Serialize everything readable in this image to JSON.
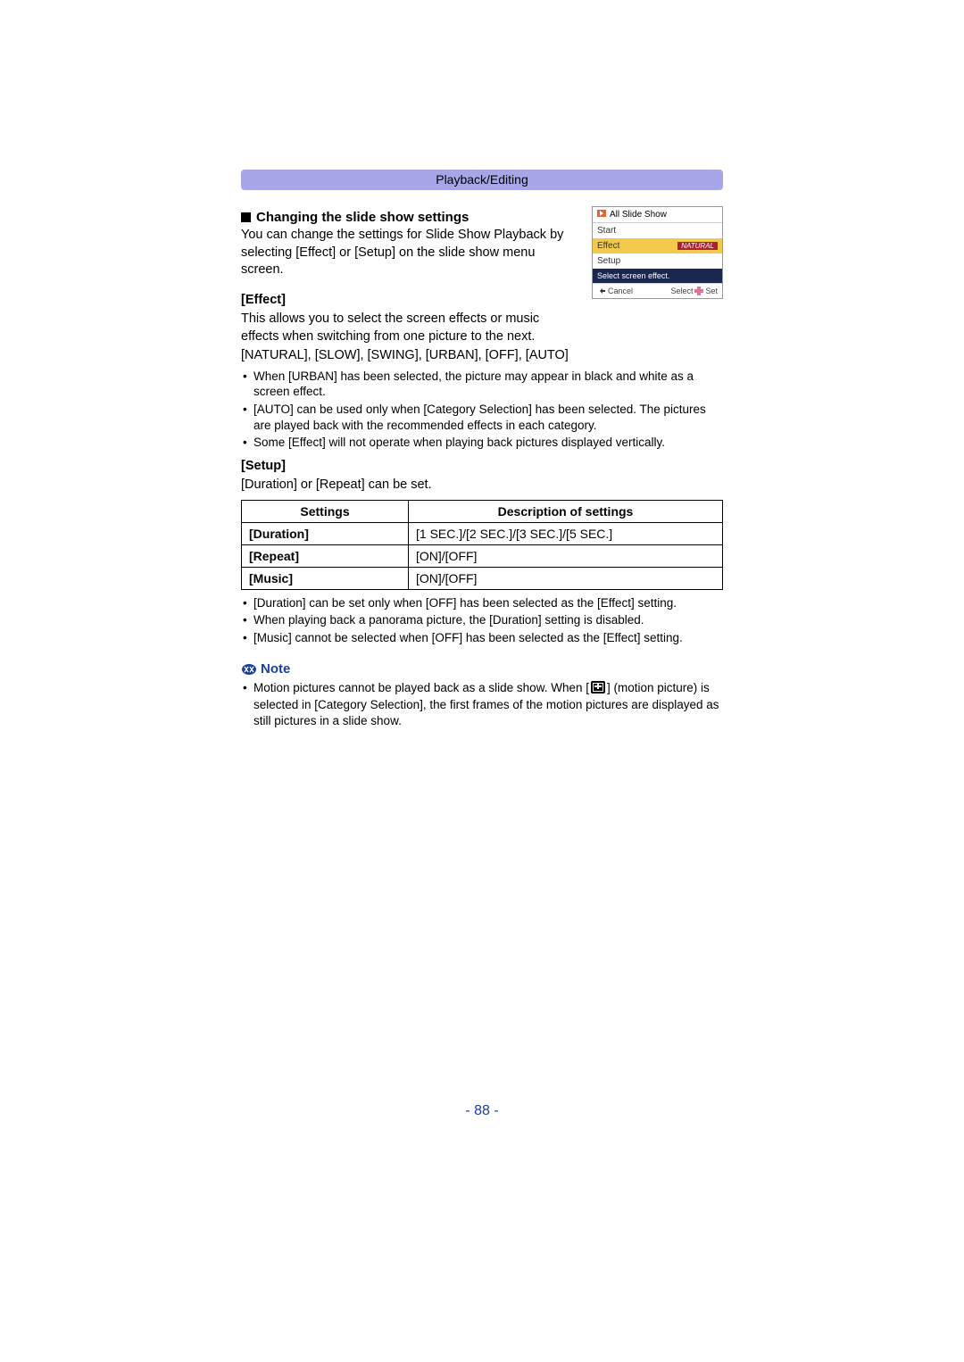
{
  "header": {
    "title": "Playback/Editing"
  },
  "section1": {
    "heading": "Changing the slide show settings",
    "intro": "You can change the settings for Slide Show Playback by selecting [Effect] or [Setup] on the slide show menu screen."
  },
  "effect": {
    "heading": "[Effect]",
    "desc": "This allows you to select the screen effects or music effects when switching from one picture to the next.",
    "options": "[NATURAL], [SLOW], [SWING], [URBAN], [OFF], [AUTO]",
    "bullets": [
      "When [URBAN] has been selected, the picture may appear in black and white as a screen effect.",
      "[AUTO] can be used only when [Category Selection] has been selected. The pictures are played back with the recommended effects in each category.",
      "Some [Effect] will not operate when playing back pictures displayed vertically."
    ]
  },
  "setup": {
    "heading": "[Setup]",
    "desc": "[Duration] or [Repeat] can be set.",
    "table": {
      "head": [
        "Settings",
        "Description of settings"
      ],
      "rows": [
        [
          "[Duration]",
          "[1 SEC.]/[2 SEC.]/[3 SEC.]/[5 SEC.]"
        ],
        [
          "[Repeat]",
          "[ON]/[OFF]"
        ],
        [
          "[Music]",
          "[ON]/[OFF]"
        ]
      ]
    },
    "bullets_after": [
      "[Duration] can be set only when [OFF] has been selected as the [Effect] setting.",
      "When playing back a panorama picture, the [Duration] setting is disabled.",
      "[Music] cannot be selected when [OFF] has been selected as the [Effect] setting."
    ]
  },
  "note": {
    "heading": "Note",
    "text_before": "Motion pictures cannot be played back as a slide show. When [",
    "text_after": "] (motion picture) is selected in [Category Selection], the first frames of the motion pictures are displayed as still pictures in a slide show."
  },
  "camera_ui": {
    "title": "All Slide Show",
    "items": [
      "Start",
      "Effect",
      "Setup"
    ],
    "selected_value": "NATURAL",
    "hint": "Select screen effect.",
    "footer_left": "Cancel",
    "footer_right_a": "Select",
    "footer_right_b": "Set"
  },
  "page_number": "- 88 -"
}
